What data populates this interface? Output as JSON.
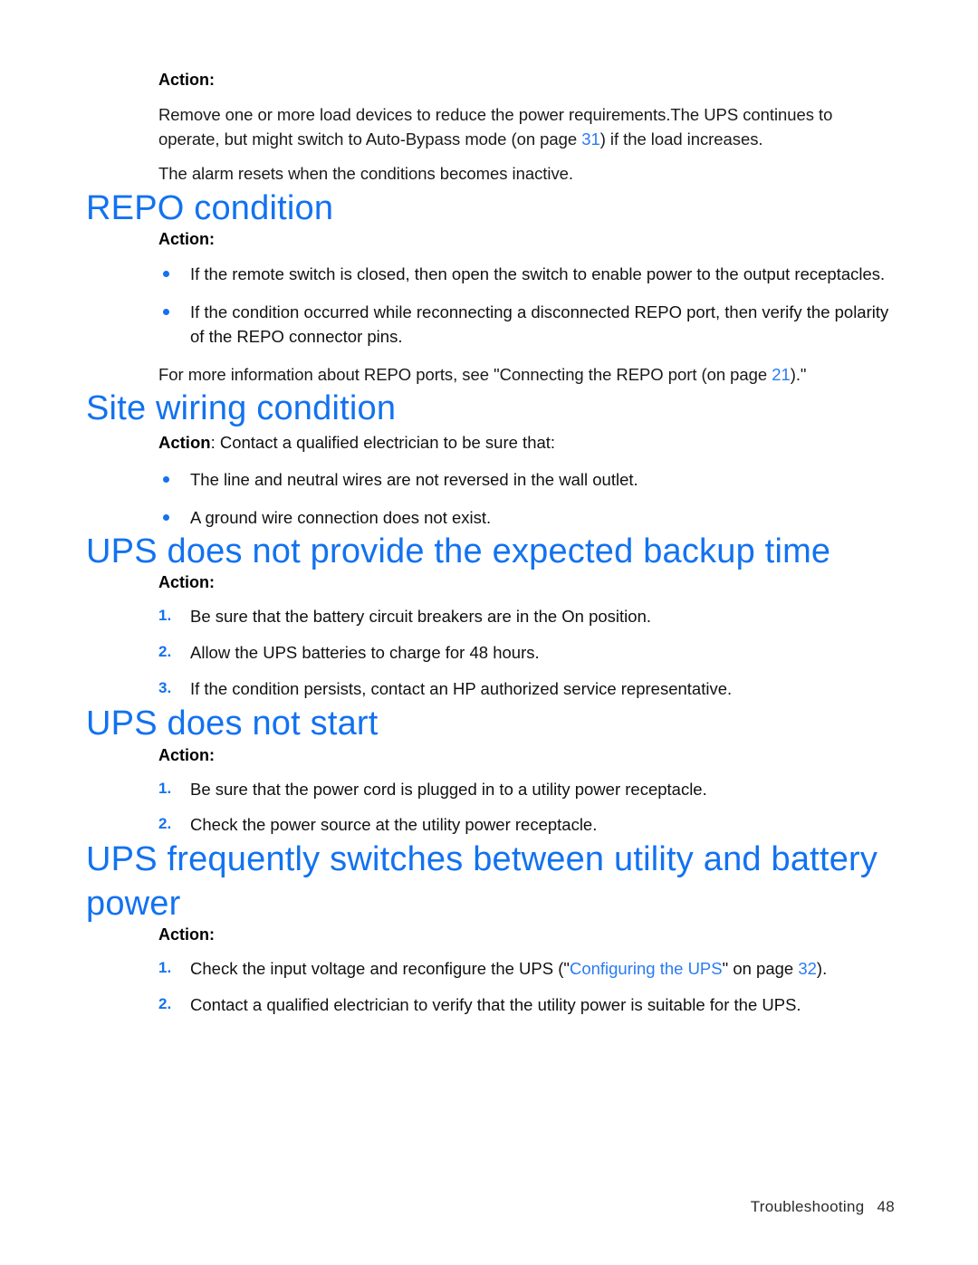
{
  "document": {
    "type": "hp-ups-user-guide-page",
    "footer": {
      "chapter": "Troubleshooting",
      "page_number": "48"
    },
    "accent_color": "#1272f0",
    "link_color": "#2a7bf2"
  },
  "intro_block": {
    "action_label": "Action",
    "action_colon": ":",
    "paragraph_1_part_1": "Remove one or more load devices to reduce the power requirements.The UPS continues to operate, but might switch to Auto-Bypass mode (on page ",
    "paragraph_1_pagelink": "31",
    "paragraph_1_part_2": ") if the load increases.",
    "paragraph_2": "The alarm resets when the conditions becomes inactive."
  },
  "sections": [
    {
      "id": "repo-condition",
      "heading": "REPO condition",
      "action_label": "Action:",
      "bullets": [
        "If the remote switch is closed, then open the switch to enable power to the output receptacles.",
        "If the condition occurred while reconnecting a disconnected REPO port, then verify the polarity of the REPO connector pins."
      ],
      "closing_part_1": "For more information about REPO ports, see \"Connecting the REPO port (on page ",
      "closing_pagelink": "21",
      "closing_part_2": ").\""
    },
    {
      "id": "site-wiring-condition",
      "heading": "Site wiring condition",
      "action_label": "Action",
      "action_rest": ": Contact a qualified electrician to be sure that:",
      "bullets": [
        "The line and neutral wires are not reversed in the wall outlet.",
        "A ground wire connection does not exist."
      ]
    },
    {
      "id": "ups-backup-time",
      "heading": "UPS does not provide the expected backup time",
      "action_label": "Action:",
      "steps": [
        {
          "num": "1.",
          "text": "Be sure that the battery circuit breakers are in the On position."
        },
        {
          "num": "2.",
          "text": "Allow the UPS batteries to charge for 48 hours."
        },
        {
          "num": "3.",
          "text": "If the condition persists, contact an HP authorized service representative."
        }
      ]
    },
    {
      "id": "ups-does-not-start",
      "heading": "UPS does not start",
      "action_label": "Action:",
      "steps": [
        {
          "num": "1.",
          "text": "Be sure that the power cord is plugged in to a utility power receptacle."
        },
        {
          "num": "2.",
          "text": "Check the power source at the utility power receptacle."
        }
      ]
    },
    {
      "id": "ups-frequently-switches",
      "heading": "UPS frequently switches between utility and battery power",
      "action_label": "Action:",
      "steps": [
        {
          "num": "1.",
          "text_part_1": "Check the input voltage and reconfigure the UPS (\"",
          "xref": "Configuring the UPS",
          "text_part_2": "\" on page ",
          "pagelink": "32",
          "text_part_3": ")."
        },
        {
          "num": "2.",
          "text": "Contact a qualified electrician to verify that the utility power is suitable for the UPS."
        }
      ]
    }
  ]
}
